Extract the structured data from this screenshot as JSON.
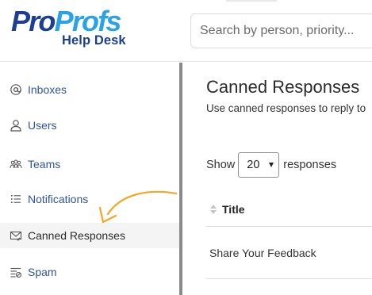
{
  "header": {
    "logo_pro": "Pro",
    "logo_profs": "Profs",
    "logo_subtitle": "Help Desk",
    "search_placeholder": "Search by person, priority..."
  },
  "sidebar": {
    "items": [
      {
        "label": "Inboxes",
        "icon": "at-icon",
        "active": false
      },
      {
        "label": "Users",
        "icon": "user-icon",
        "active": false
      },
      {
        "label": "Teams",
        "icon": "team-icon",
        "active": false
      },
      {
        "label": "Notifications",
        "icon": "list-icon",
        "active": false
      },
      {
        "label": "Canned Responses",
        "icon": "envelope-icon",
        "active": true
      },
      {
        "label": "Spam",
        "icon": "spam-filter-icon",
        "active": false
      }
    ]
  },
  "main": {
    "title": "Canned Responses",
    "subtitle": "Use canned responses to reply to",
    "show_label": "Show",
    "page_size": "20",
    "responses_label": "responses",
    "table": {
      "columns": [
        "Title"
      ],
      "rows": [
        [
          "Share Your Feedback"
        ]
      ]
    }
  },
  "colors": {
    "brand_dark": "#1c3f94",
    "brand_light": "#2aa3e6",
    "nav_link": "#2f5597",
    "annotation_arrow": "#f5a623"
  }
}
